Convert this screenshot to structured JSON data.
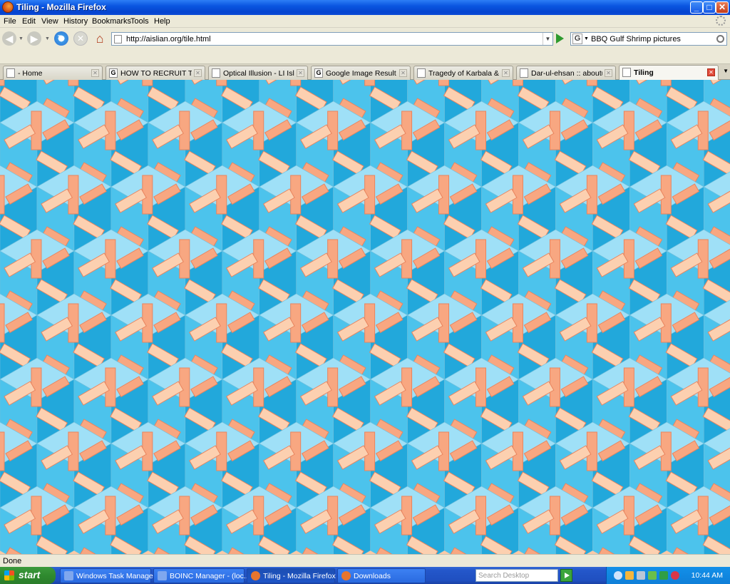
{
  "window": {
    "title": "Tiling - Mozilla Firefox"
  },
  "menu": {
    "items": [
      "File",
      "Edit",
      "View",
      "History",
      "Bookmarks",
      "Tools",
      "Help"
    ]
  },
  "nav": {
    "url": "http://aislian.org/tile.html",
    "search_engine": "G",
    "search_query": "BBQ Gulf Shrimp pictures"
  },
  "tabs": [
    {
      "label": "- Home",
      "icon": "page-icon"
    },
    {
      "label": "HOW TO RECRUIT THE...",
      "icon": "google-icon"
    },
    {
      "label": "Optical Illusion - LI Isla...",
      "icon": "page-icon"
    },
    {
      "label": "Google Image Result fo...",
      "icon": "google-icon"
    },
    {
      "label": "Tragedy of Karbala & M...",
      "icon": "page-icon"
    },
    {
      "label": "Dar-ul-ehsan :: aboutu...",
      "icon": "page-icon"
    },
    {
      "label": "Tiling",
      "icon": "page-icon",
      "active": true
    }
  ],
  "content": {
    "pattern": "isometric-cube-tiling",
    "colors": {
      "blue_light": "#9fe0f7",
      "blue": "#4cc3ec",
      "blue_dark": "#22a8db",
      "orange_light": "#fcd0b0",
      "orange": "#f8a781",
      "orange_dark": "#e8845e"
    }
  },
  "status": {
    "text": "Done"
  },
  "taskbar": {
    "start_label": "start",
    "tasks": [
      "Windows Task Manager",
      "BOINC Manager - (loc...",
      "Tiling - Mozilla Firefox",
      "Downloads"
    ],
    "desk_search_placeholder": "Search Desktop",
    "clock": "10:44 AM"
  }
}
